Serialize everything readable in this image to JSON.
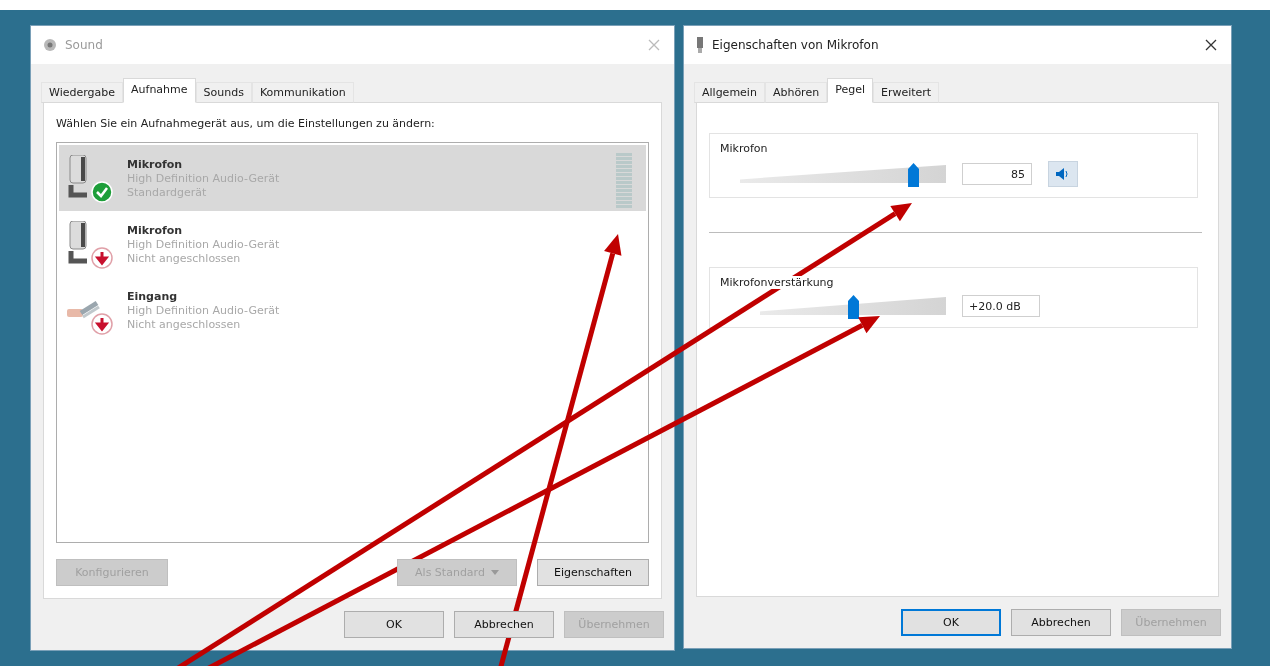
{
  "sound_dialog": {
    "title": "Sound",
    "tabs": [
      {
        "label": "Wiedergabe",
        "selected": false
      },
      {
        "label": "Aufnahme",
        "selected": true
      },
      {
        "label": "Sounds",
        "selected": false
      },
      {
        "label": "Kommunikation",
        "selected": false
      }
    ],
    "instruction": "Wählen Sie ein Aufnahmegerät aus, um die Einstellungen zu ändern:",
    "devices": [
      {
        "name": "Mikrofon",
        "driver": "High Definition Audio-Gerät",
        "status": "Standardgerät",
        "kind": "microphone",
        "is_default": true,
        "connected": true,
        "selected": true
      },
      {
        "name": "Mikrofon",
        "driver": "High Definition Audio-Gerät",
        "status": "Nicht angeschlossen",
        "kind": "microphone",
        "is_default": false,
        "connected": false,
        "selected": false
      },
      {
        "name": "Eingang",
        "driver": "High Definition Audio-Gerät",
        "status": "Nicht angeschlossen",
        "kind": "jack",
        "is_default": false,
        "connected": false,
        "selected": false
      }
    ],
    "buttons": [
      {
        "label": "Konfigurieren",
        "kind": "plain",
        "disabled": true
      },
      {
        "label": "Als Standard",
        "kind": "dropdown",
        "disabled": true
      },
      {
        "label": "Eigenschaften",
        "kind": "plain",
        "disabled": false
      }
    ],
    "footer_buttons": [
      {
        "label": "OK",
        "disabled": false,
        "focused": false
      },
      {
        "label": "Abbrechen",
        "disabled": false,
        "focused": false
      },
      {
        "label": "Übernehmen",
        "disabled": true,
        "focused": false
      }
    ]
  },
  "properties_dialog": {
    "title": "Eigenschaften von Mikrofon",
    "tabs": [
      {
        "label": "Allgemein",
        "selected": false
      },
      {
        "label": "Abhören",
        "selected": false
      },
      {
        "label": "Pegel",
        "selected": true
      },
      {
        "label": "Erweitert",
        "selected": false
      }
    ],
    "groups": [
      {
        "label": "Mikrofon",
        "level": 0.84,
        "value": "85",
        "kind": "volume"
      },
      {
        "label": "Mikrofonverstärkung",
        "level": 0.5,
        "value": "+20.0 dB",
        "kind": "boost"
      }
    ],
    "footer_buttons": [
      {
        "label": "OK",
        "disabled": false,
        "focused": true
      },
      {
        "label": "Abbrechen",
        "disabled": false,
        "focused": false
      },
      {
        "label": "Übernehmen",
        "disabled": true,
        "focused": false
      }
    ]
  }
}
